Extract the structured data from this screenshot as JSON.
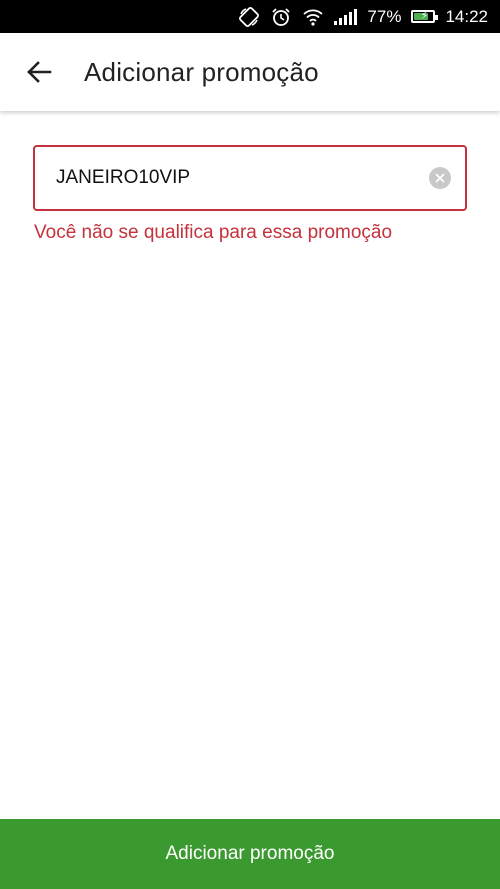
{
  "status_bar": {
    "battery_percent": "77%",
    "battery_level": 0.77,
    "time": "14:22",
    "icons": [
      "screen-rotation-icon",
      "alarm-icon",
      "wifi-icon",
      "signal-icon",
      "battery-charging-icon"
    ]
  },
  "app_bar": {
    "back_icon": "arrow-left-icon",
    "title": "Adicionar promoção"
  },
  "promo_field": {
    "value": "JANEIRO10VIP",
    "clear_icon": "clear-icon"
  },
  "error": {
    "message": "Você não se qualifica para essa promoção"
  },
  "submit": {
    "label": "Adicionar promoção"
  },
  "colors": {
    "accent_green": "#3b9a2f",
    "error_red": "#c5313c",
    "status_bar": "#000000"
  }
}
